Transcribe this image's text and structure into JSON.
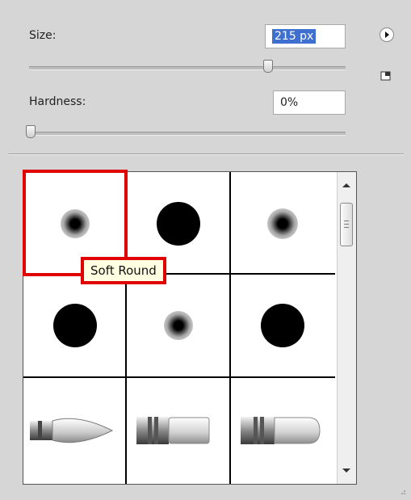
{
  "size": {
    "label": "Size:",
    "value": "215 px",
    "slider_fraction": 0.74
  },
  "hardness": {
    "label": "Hardness:",
    "value": "0%",
    "slider_fraction": 0.0
  },
  "panel_menu_icon": "arrow-right-circle-icon",
  "new_preset_icon": "new-preset-icon",
  "brush_presets": [
    {
      "tip": "soft-round",
      "diameter_hint": "small"
    },
    {
      "tip": "hard-round",
      "diameter_hint": "large"
    },
    {
      "tip": "soft-round",
      "diameter_hint": "small"
    },
    {
      "tip": "hard-round",
      "diameter_hint": "large"
    },
    {
      "tip": "soft-round",
      "diameter_hint": "small"
    },
    {
      "tip": "hard-round",
      "diameter_hint": "large"
    },
    {
      "tip": "pointed-brush"
    },
    {
      "tip": "flat-brush"
    },
    {
      "tip": "rounded-flat-brush"
    }
  ],
  "tooltip": {
    "text": "Soft Round"
  },
  "colors": {
    "highlight": "#e00000",
    "selection": "#3f6fcf",
    "panel": "#d6d6d6"
  }
}
